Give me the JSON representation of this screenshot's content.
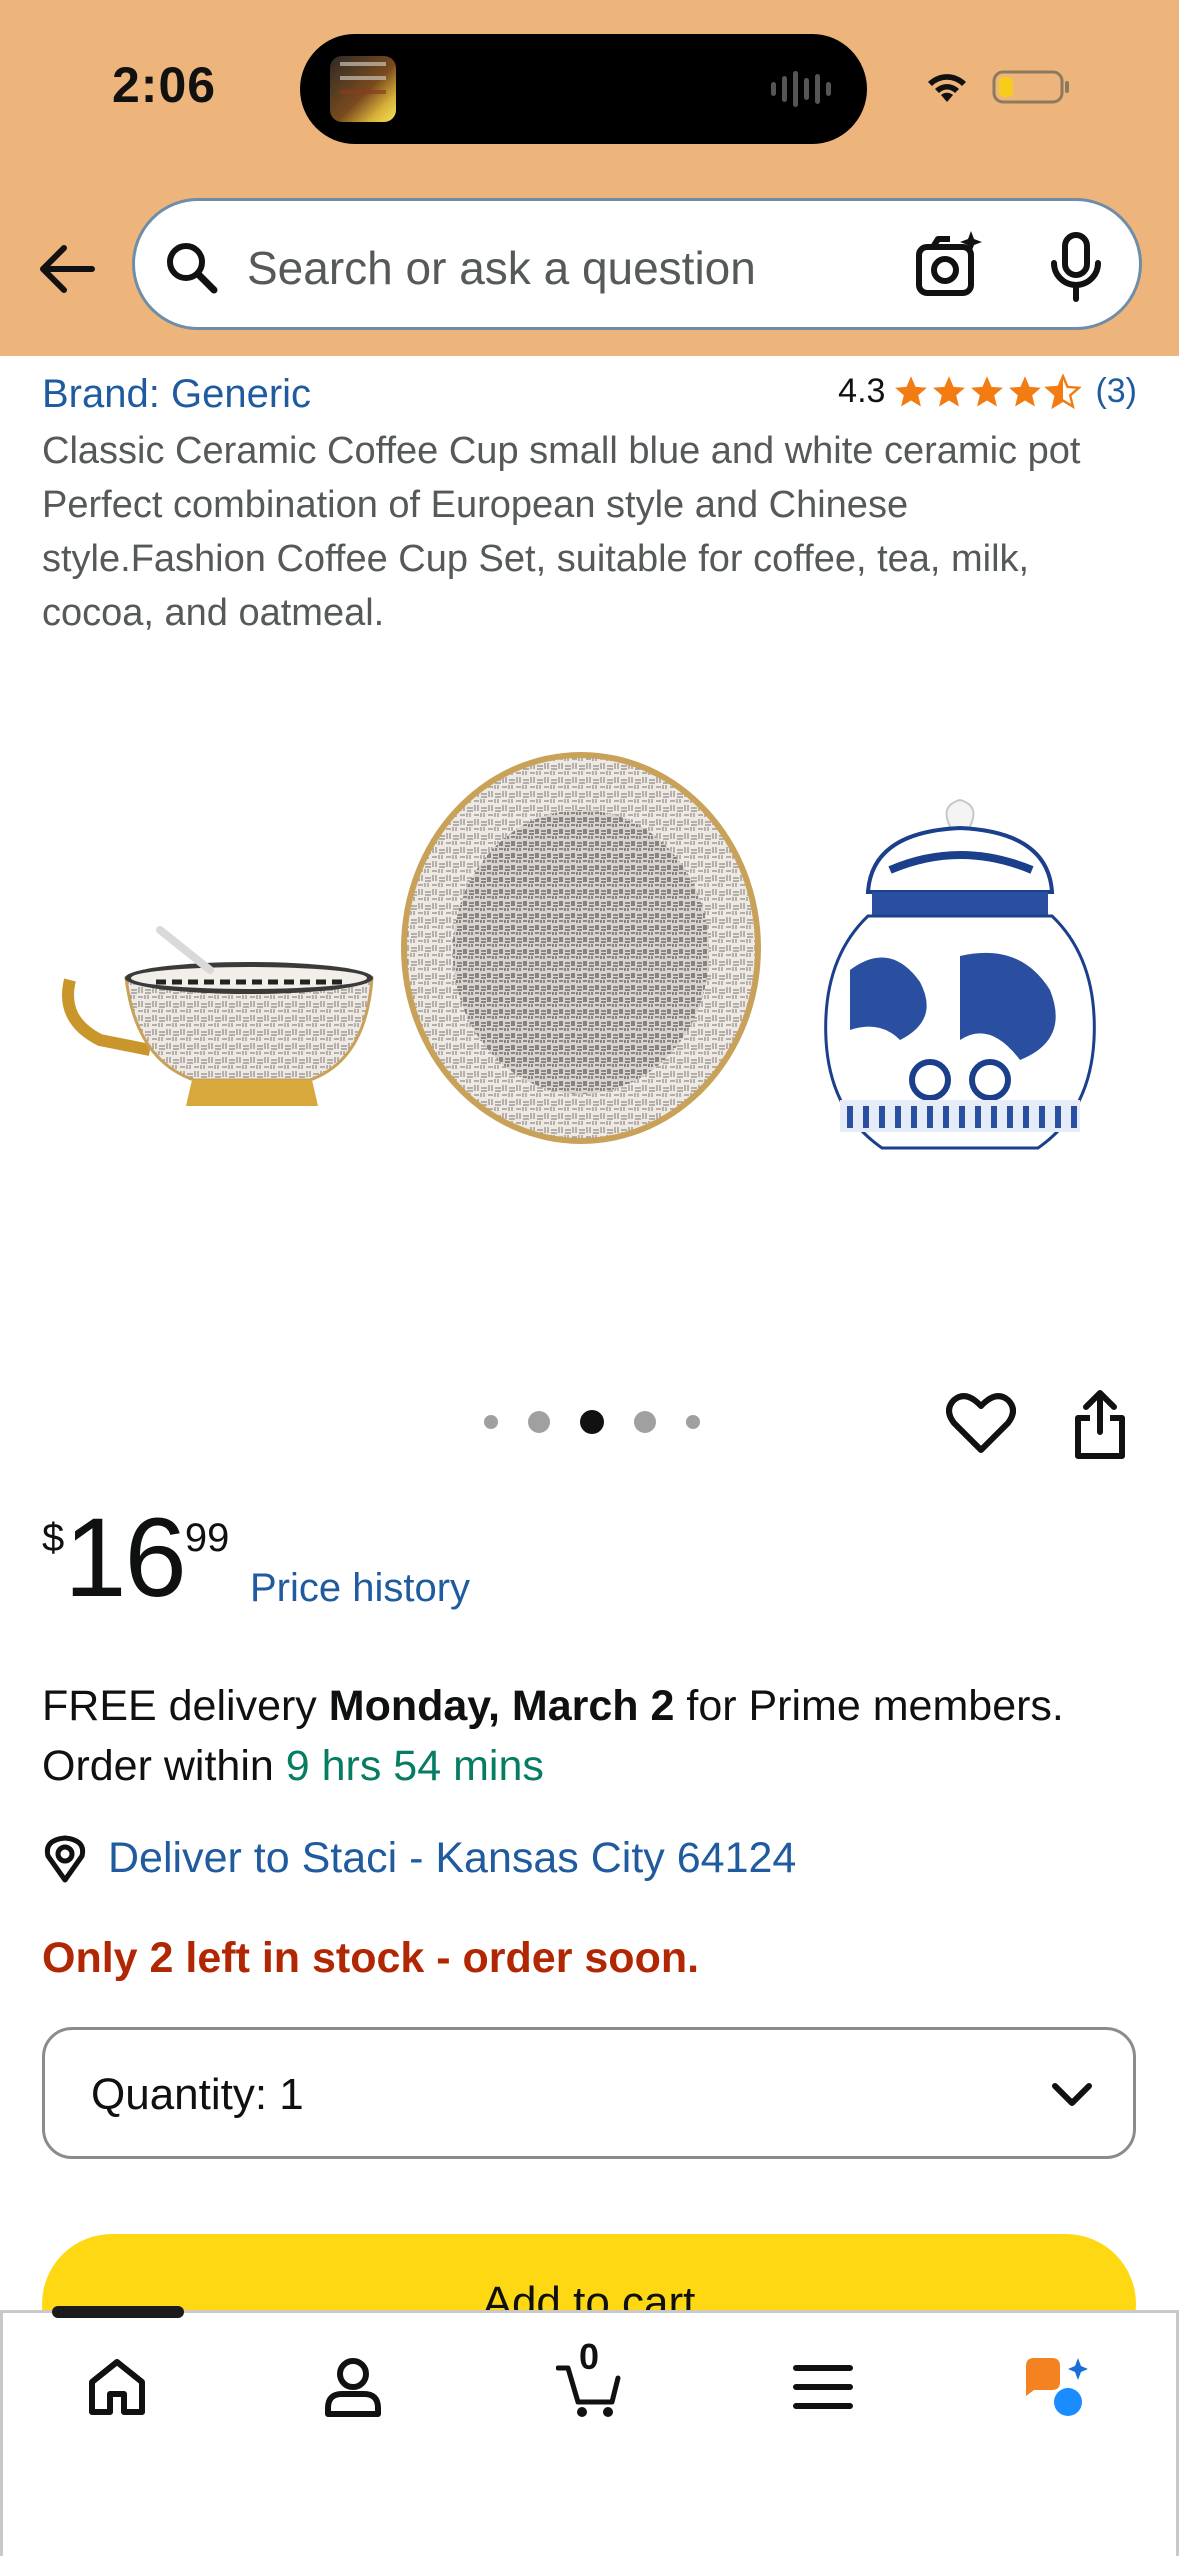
{
  "status_bar": {
    "time": "2:06",
    "icons": [
      "wifi-icon",
      "battery-icon"
    ]
  },
  "header": {
    "back_icon": "back-arrow-icon",
    "search_placeholder": "Search or ask a question",
    "icons": [
      "search-icon",
      "camera-icon",
      "mic-icon"
    ]
  },
  "product": {
    "brand": "Brand: Generic",
    "rating": "4.3",
    "rating_stars": 4.3,
    "rating_count": "(3)",
    "title": "Classic Ceramic Coffee Cup small blue and white ceramic pot Perfect combination of European style and Chinese style.Fashion Coffee Cup Set, suitable for coffee, tea, milk, cocoa, and oatmeal.",
    "image_dots": 5,
    "active_dot": 3,
    "price_symbol": "$",
    "price_whole": "16",
    "price_fraction": "99",
    "price_history": "Price history"
  },
  "delivery": {
    "prefix": "FREE delivery ",
    "date": "Monday, March 2",
    "suffix": " for Prime members. Order within ",
    "countdown": "9 hrs 54 mins",
    "deliver_to": "Deliver to Staci - Kansas City 64124",
    "stock": "Only 2 left in stock - order soon."
  },
  "purchase": {
    "quantity_label": "Quantity:  1",
    "add_to_cart": "Add to cart"
  },
  "bottom_nav": {
    "cart_count": "0",
    "items": [
      "home-icon",
      "account-icon",
      "cart-icon",
      "menu-icon",
      "rufus-icon"
    ]
  },
  "colors": {
    "header_bg": "#edb57b",
    "link": "#1f5b9e",
    "stock_red": "#b12704",
    "countdown_green": "#067d62",
    "cart_button": "#ffd814",
    "star": "#f27b12"
  }
}
